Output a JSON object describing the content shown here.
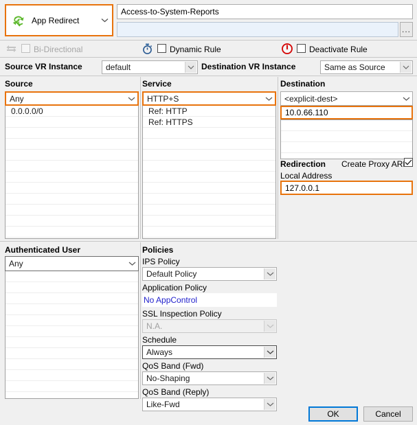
{
  "colors": {
    "accent_orange": "#e8730c",
    "focus_blue": "#0078d7",
    "link_blue": "#2222cc",
    "icon_green": "#5cb82b",
    "icon_red": "#d50000",
    "window_bg": "#f0f0f0"
  },
  "header": {
    "rule_type": "App Redirect",
    "rule_type_icon": "redirect-arrows-icon",
    "dropdown_icon": "chevron-down-icon",
    "name_value": "Access-to-System-Reports",
    "name_placeholder": "",
    "comment_value": "",
    "comment_placeholder": "",
    "browse_label": "..."
  },
  "options_row": {
    "bi_directional": {
      "label": "Bi-Directional",
      "icon": "bi-directional-arrows-icon",
      "checked": false,
      "disabled": true
    },
    "dynamic_rule": {
      "label": "Dynamic Rule",
      "icon": "stopwatch-icon",
      "checked": false,
      "disabled": false
    },
    "deactivate_rule": {
      "label": "Deactivate Rule",
      "icon": "power-icon",
      "checked": false,
      "disabled": false
    }
  },
  "vr_instance": {
    "source_label": "Source VR Instance",
    "source_value": "default",
    "destination_label": "Destination VR Instance",
    "destination_value": "Same as Source"
  },
  "source": {
    "title": "Source",
    "selector_value": "Any",
    "items": [
      "0.0.0.0/0"
    ],
    "empty_rows": 11
  },
  "service": {
    "title": "Service",
    "selector_value": "HTTP+S",
    "items": [
      "Ref: HTTP",
      "Ref: HTTPS"
    ],
    "empty_rows": 10
  },
  "destination": {
    "title": "Destination",
    "selector_value": "<explicit-dest>",
    "items": [
      "10.0.66.110"
    ],
    "empty_rows": 3
  },
  "redirection": {
    "title": "Redirection",
    "proxy_arp_label": "Create Proxy ARP",
    "proxy_arp_checked": true,
    "local_address_label": "Local Address",
    "local_address_value": "127.0.0.1"
  },
  "authenticated_user": {
    "title": "Authenticated User",
    "selector_value": "Any",
    "items": [],
    "empty_rows": 11
  },
  "policies": {
    "title": "Policies",
    "fields": [
      {
        "label": "IPS Policy",
        "value": "Default Policy",
        "style": "combo",
        "disabled": false
      },
      {
        "label": "Application Policy",
        "value": "No AppControl",
        "style": "link",
        "disabled": false
      },
      {
        "label": "SSL Inspection Policy",
        "value": "N.A.",
        "style": "combo",
        "disabled": true
      },
      {
        "label": "Schedule",
        "value": "Always",
        "style": "combo-dark",
        "disabled": false
      },
      {
        "label": "QoS Band (Fwd)",
        "value": "No-Shaping",
        "style": "combo",
        "disabled": false
      },
      {
        "label": "QoS Band (Reply)",
        "value": "Like-Fwd",
        "style": "combo",
        "disabled": false
      }
    ]
  },
  "footer": {
    "ok_label": "OK",
    "cancel_label": "Cancel"
  }
}
